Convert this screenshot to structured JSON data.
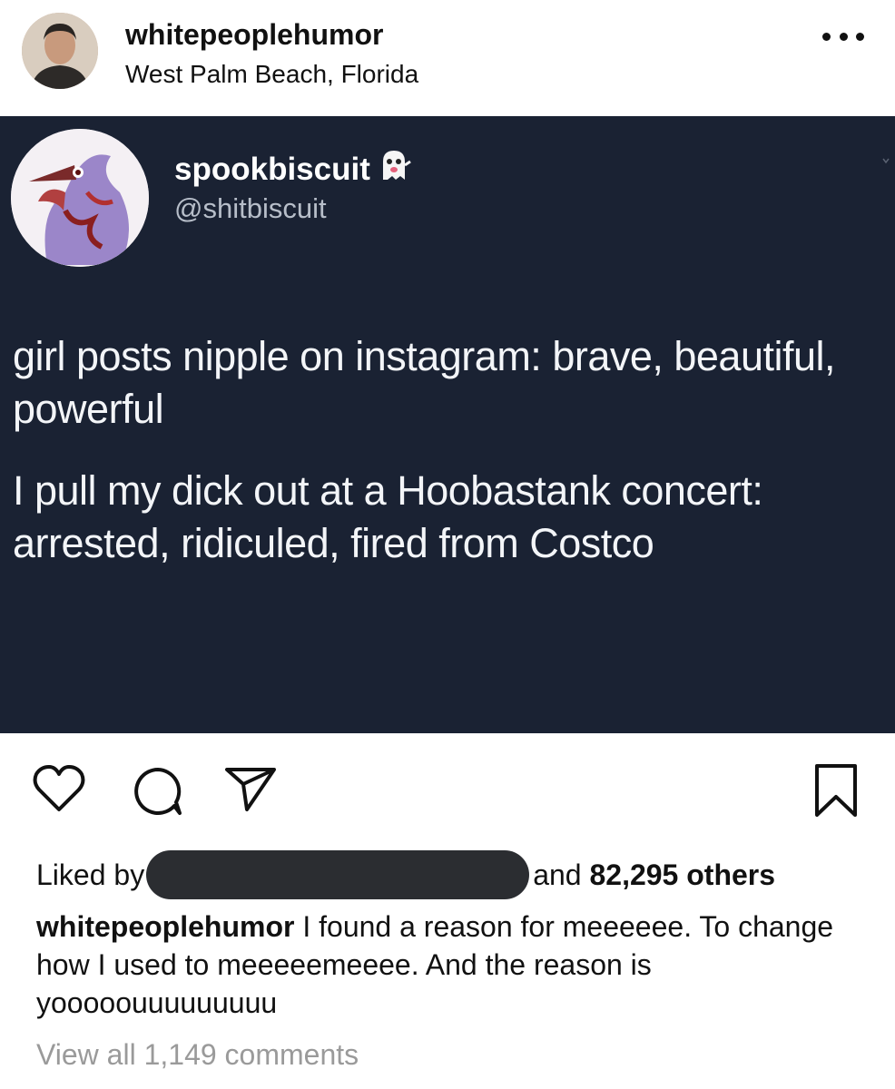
{
  "post": {
    "username": "whitepeoplehumor",
    "location": "West Palm Beach, Florida",
    "more_icon": "more-horizontal-icon"
  },
  "tweet": {
    "display_name": "spookbiscuit",
    "name_emoji": "👻",
    "handle": "@shitbiscuit",
    "paragraphs": [
      "girl posts nipple on instagram: brave, beautiful, powerful",
      "I pull my dick out at a Hoobastank concert: arrested, ridiculed, fired from Costco"
    ],
    "colors": {
      "background": "#1a2233",
      "text": "#f3f5f8",
      "handle": "#b7bec9"
    }
  },
  "actions": {
    "icons": [
      "heart-icon",
      "comment-icon",
      "share-icon",
      "bookmark-icon"
    ]
  },
  "likes": {
    "prefix": "Liked by",
    "suffix_and": "and",
    "count_text": "82,295 others"
  },
  "caption": {
    "username": "whitepeoplehumor",
    "text": "I found a reason for meeeeee. To change how I used to meeeeemeeee. And the reason is yooooouuuuuuuuu"
  },
  "comments": {
    "view_all": "View all 1,149 comments"
  }
}
